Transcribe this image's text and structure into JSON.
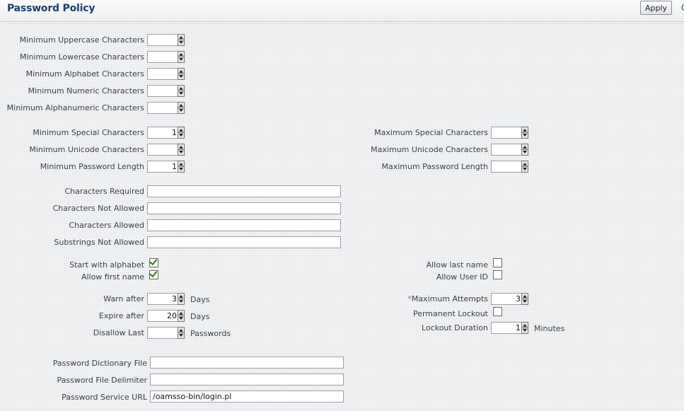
{
  "header": {
    "title": "Password Policy",
    "apply_label": "Apply",
    "edge_text": "C"
  },
  "fields": {
    "min_uppercase": {
      "label": "Minimum Uppercase Characters",
      "value": ""
    },
    "min_lowercase": {
      "label": "Minimum Lowercase Characters",
      "value": ""
    },
    "min_alphabet": {
      "label": "Minimum Alphabet Characters",
      "value": ""
    },
    "min_numeric": {
      "label": "Minimum Numeric Characters",
      "value": ""
    },
    "min_alphanumeric": {
      "label": "Minimum Alphanumeric Characters",
      "value": ""
    },
    "min_special": {
      "label": "Minimum Special Characters",
      "value": "1"
    },
    "min_unicode": {
      "label": "Minimum Unicode Characters",
      "value": ""
    },
    "min_length": {
      "label": "Minimum Password Length",
      "value": "1"
    },
    "max_special": {
      "label": "Maximum Special Characters",
      "value": ""
    },
    "max_unicode": {
      "label": "Maximum Unicode Characters",
      "value": ""
    },
    "max_length": {
      "label": "Maximum Password Length",
      "value": ""
    },
    "chars_required": {
      "label": "Characters Required",
      "value": ""
    },
    "chars_not_allowed": {
      "label": "Characters Not Allowed",
      "value": ""
    },
    "chars_allowed": {
      "label": "Characters Allowed",
      "value": ""
    },
    "substrings_not_allowed": {
      "label": "Substrings Not Allowed",
      "value": ""
    },
    "start_with_alphabet": {
      "label": "Start with alphabet",
      "checked": true
    },
    "allow_first_name": {
      "label": "Allow first name",
      "checked": true
    },
    "allow_last_name": {
      "label": "Allow last name",
      "checked": false
    },
    "allow_user_id": {
      "label": "Allow User ID",
      "checked": false
    },
    "warn_after": {
      "label": "Warn after",
      "value": "3",
      "unit": "Days"
    },
    "expire_after": {
      "label": "Expire after",
      "value": "20",
      "unit": "Days"
    },
    "disallow_last": {
      "label": "Disallow Last",
      "value": "",
      "unit": "Passwords"
    },
    "max_attempts": {
      "label": "Maximum Attempts",
      "required_mark": "*",
      "value": "3"
    },
    "permanent_lockout": {
      "label": "Permanent Lockout",
      "checked": false
    },
    "lockout_duration": {
      "label": "Lockout Duration",
      "value": "1",
      "unit": "Minutes"
    },
    "dictionary_file": {
      "label": "Password Dictionary File",
      "value": ""
    },
    "file_delimiter": {
      "label": "Password File Delimiter",
      "value": ""
    },
    "service_url": {
      "label": "Password Service URL",
      "value": "/oamsso-bin/login.pl"
    }
  }
}
